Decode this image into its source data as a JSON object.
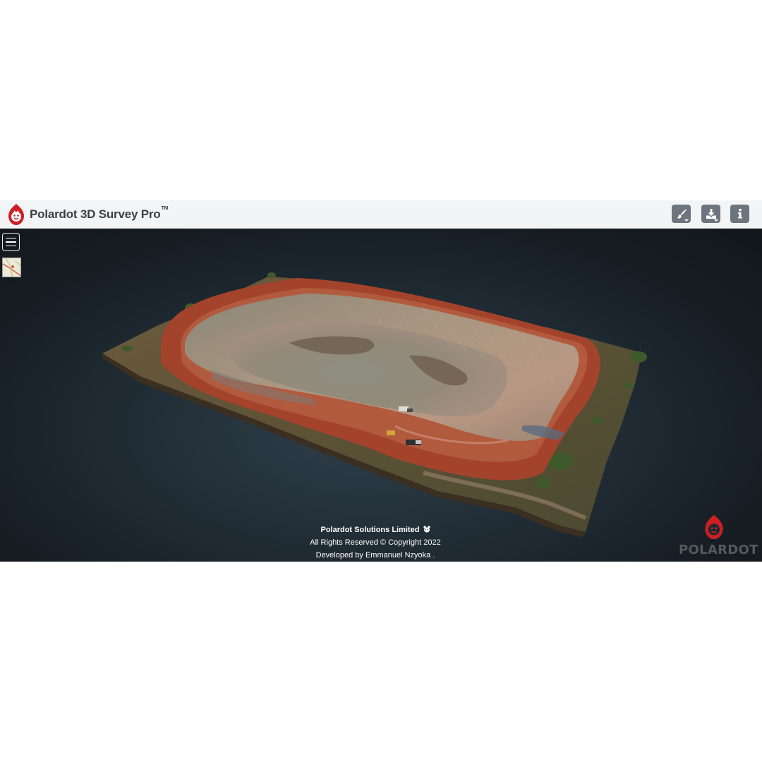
{
  "app": {
    "title": "Polardot 3D Survey Pro",
    "trademark": "TM",
    "brand_color": "#cc1f24"
  },
  "toolbar": {
    "buttons": [
      {
        "name": "appearance",
        "icon": "paint-brush-icon",
        "has_dropdown": true
      },
      {
        "name": "download",
        "icon": "download-icon",
        "has_dropdown": true
      },
      {
        "name": "info",
        "icon": "info-icon",
        "has_dropdown": false
      }
    ],
    "button_color": "#6c757d"
  },
  "viewer": {
    "menu_icon": "hamburger-menu-icon",
    "map_thumbnail_icon": "map-thumbnail-icon",
    "model": "3D point cloud of an open-pit quarry with red haul road perimeter and vehicles"
  },
  "footer": {
    "company": "Polardot Solutions Limited",
    "copyright": "All Rights Reserved © Copyright 2022",
    "developer": "Developed by Emmanuel Nzyoka ."
  },
  "watermark": {
    "text": "POLARDOT"
  }
}
